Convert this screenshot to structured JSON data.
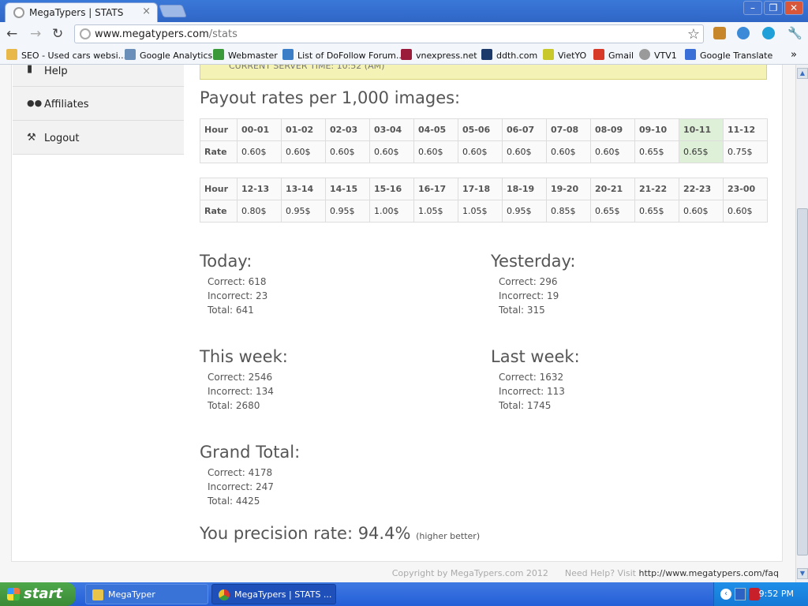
{
  "browser": {
    "tab_title": "MegaTypers | STATS",
    "tab_close": "×",
    "url_domain": "www.megatypers.com",
    "url_path": "/stats",
    "window_buttons": [
      "–",
      "❐",
      "✕"
    ]
  },
  "bookmarks": [
    {
      "label": "SEO - Used cars websi...",
      "icon": "folder-icon",
      "color": "#e8b84a"
    },
    {
      "label": "Google Analytics",
      "icon": "analytics-icon",
      "color": "#6a8fb8"
    },
    {
      "label": "Webmaster",
      "icon": "webmaster-icon",
      "color": "#3a9a3a"
    },
    {
      "label": "List of DoFollow Forum...",
      "icon": "pin-icon",
      "color": "#3a7ec8"
    },
    {
      "label": "vnexpress.net",
      "icon": "vnexpress-icon",
      "color": "#9a1c3a"
    },
    {
      "label": "ddth.com",
      "icon": "ddth-icon",
      "color": "#1c3a6a"
    },
    {
      "label": "VietYO",
      "icon": "vietyo-icon",
      "color": "#c8c82a"
    },
    {
      "label": "Gmail",
      "icon": "gmail-icon",
      "color": "#d83a2a"
    },
    {
      "label": "VTV1",
      "icon": "globe-icon",
      "color": "#9a9a9a"
    },
    {
      "label": "Google Translate",
      "icon": "translate-icon",
      "color": "#3a6fd8"
    }
  ],
  "sidebar": {
    "items": [
      {
        "label": "Help",
        "icon": "book-icon"
      },
      {
        "label": "Affiliates",
        "icon": "users-icon"
      },
      {
        "label": "Logout",
        "icon": "running-man-icon"
      }
    ]
  },
  "notice": {
    "text": "CURRENT SERVER TIME: 10:52 (AM)"
  },
  "payout": {
    "title": "Payout rates per 1,000 images:",
    "hour_label": "Hour",
    "rate_label": "Rate",
    "highlight_color": "#dff0d8",
    "table1": {
      "hours": [
        "00-01",
        "01-02",
        "02-03",
        "03-04",
        "04-05",
        "05-06",
        "06-07",
        "07-08",
        "08-09",
        "09-10",
        "10-11",
        "11-12"
      ],
      "rates": [
        "0.60$",
        "0.60$",
        "0.60$",
        "0.60$",
        "0.60$",
        "0.60$",
        "0.60$",
        "0.60$",
        "0.60$",
        "0.65$",
        "0.65$",
        "0.75$"
      ],
      "highlight_index": 10
    },
    "table2": {
      "hours": [
        "12-13",
        "13-14",
        "14-15",
        "15-16",
        "16-17",
        "17-18",
        "18-19",
        "19-20",
        "20-21",
        "21-22",
        "22-23",
        "23-00"
      ],
      "rates": [
        "0.80$",
        "0.95$",
        "0.95$",
        "1.00$",
        "1.05$",
        "1.05$",
        "0.95$",
        "0.85$",
        "0.65$",
        "0.65$",
        "0.60$",
        "0.60$"
      ],
      "highlight_index": -1
    }
  },
  "stats": {
    "today": {
      "title": "Today:",
      "correct": "Correct: 618",
      "incorrect": "Incorrect: 23",
      "total": "Total: 641"
    },
    "yesterday": {
      "title": "Yesterday:",
      "correct": "Correct: 296",
      "incorrect": "Incorrect: 19",
      "total": "Total: 315"
    },
    "this_week": {
      "title": "This week:",
      "correct": "Correct: 2546",
      "incorrect": "Incorrect: 134",
      "total": "Total: 2680"
    },
    "last_week": {
      "title": "Last week:",
      "correct": "Correct: 1632",
      "incorrect": "Incorrect: 113",
      "total": "Total: 1745"
    },
    "grand_total": {
      "title": "Grand Total:",
      "correct": "Correct: 4178",
      "incorrect": "Incorrect: 247",
      "total": "Total: 4425"
    }
  },
  "precision": {
    "label": "You precision rate: 94.4%",
    "note": "(higher better)"
  },
  "footer": {
    "copyright": "Copyright by MegaTypers.com 2012",
    "help_text": "Need Help? Visit",
    "help_link": "http://www.megatypers.com/faq"
  },
  "taskbar": {
    "start_label": "start",
    "tasks": [
      {
        "label": "MegaTyper",
        "icon": "folder-icon"
      },
      {
        "label": "MegaTypers | STATS ...",
        "icon": "chrome-icon"
      }
    ],
    "clock": "9:52 PM"
  }
}
